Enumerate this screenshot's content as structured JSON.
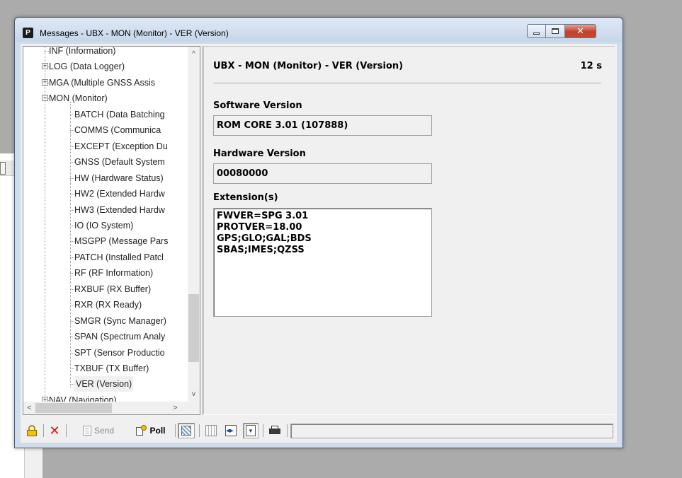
{
  "window": {
    "title": "Messages - UBX - MON (Monitor) - VER (Version)",
    "app_icon": "P"
  },
  "tree": {
    "items": [
      {
        "label": "INF (Information)",
        "level": 1,
        "expander": ""
      },
      {
        "label": "LOG (Data Logger)",
        "level": 1,
        "expander": "+"
      },
      {
        "label": "MGA (Multiple GNSS Assis",
        "level": 1,
        "expander": "+"
      },
      {
        "label": "MON (Monitor)",
        "level": 1,
        "expander": "−"
      },
      {
        "label": "BATCH (Data Batching",
        "level": 2,
        "expander": ""
      },
      {
        "label": "COMMS (Communica",
        "level": 2,
        "expander": ""
      },
      {
        "label": "EXCEPT (Exception Du",
        "level": 2,
        "expander": ""
      },
      {
        "label": "GNSS (Default System",
        "level": 2,
        "expander": ""
      },
      {
        "label": "HW (Hardware Status)",
        "level": 2,
        "expander": ""
      },
      {
        "label": "HW2 (Extended Hardw",
        "level": 2,
        "expander": ""
      },
      {
        "label": "HW3 (Extended Hardw",
        "level": 2,
        "expander": ""
      },
      {
        "label": "IO (IO System)",
        "level": 2,
        "expander": ""
      },
      {
        "label": "MSGPP (Message Pars",
        "level": 2,
        "expander": ""
      },
      {
        "label": "PATCH (Installed Patcl",
        "level": 2,
        "expander": ""
      },
      {
        "label": "RF (RF Information)",
        "level": 2,
        "expander": ""
      },
      {
        "label": "RXBUF (RX Buffer)",
        "level": 2,
        "expander": ""
      },
      {
        "label": "RXR (RX Ready)",
        "level": 2,
        "expander": ""
      },
      {
        "label": "SMGR (Sync Manager)",
        "level": 2,
        "expander": ""
      },
      {
        "label": "SPAN (Spectrum Analy",
        "level": 2,
        "expander": ""
      },
      {
        "label": "SPT (Sensor Productio",
        "level": 2,
        "expander": ""
      },
      {
        "label": "TXBUF (TX Buffer)",
        "level": 2,
        "expander": ""
      },
      {
        "label": "VER (Version)",
        "level": 2,
        "expander": "",
        "selected": true
      },
      {
        "label": "NAV (Navigation)",
        "level": 1,
        "expander": "+"
      }
    ],
    "scroll_up": "^",
    "scroll_down": "v",
    "scroll_left": "<",
    "scroll_right": ">"
  },
  "detail": {
    "title": "UBX - MON (Monitor) - VER (Version)",
    "timer": "12 s",
    "software_label": "Software Version",
    "software_value": "ROM CORE 3.01 (107888)",
    "hardware_label": "Hardware Version",
    "hardware_value": "00080000",
    "extensions_label": "Extension(s)",
    "extensions": [
      "FWVER=SPG 3.01",
      "PROTVER=18.00",
      "GPS;GLO;GAL;BDS",
      "SBAS;IMES;QZSS"
    ]
  },
  "toolbar": {
    "send_label": "Send",
    "poll_label": "Poll",
    "delete_glyph": "✕",
    "status_text": ""
  },
  "colors": {
    "titlebar": "#cfdcec",
    "close_button": "#c4402a",
    "delete_icon": "#e01010",
    "lock_icon": "#f2c300"
  }
}
